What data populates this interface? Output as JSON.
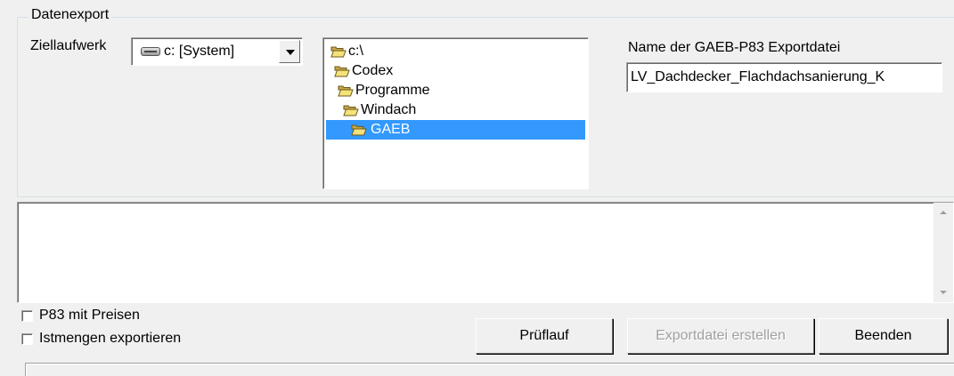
{
  "groupbox": {
    "title": "Datenexport"
  },
  "target_drive": {
    "label": "Ziellaufwerk",
    "selected": "c: [System]",
    "icon": "drive-icon"
  },
  "directory_tree": {
    "items": [
      {
        "label": "c:\\",
        "icon": "open-folder-icon"
      },
      {
        "label": "Codex",
        "icon": "open-folder-icon"
      },
      {
        "label": "Programme",
        "icon": "open-folder-icon"
      },
      {
        "label": "Windach",
        "icon": "open-folder-icon"
      },
      {
        "label": "GAEB",
        "icon": "open-folder-icon",
        "selected": true
      }
    ]
  },
  "export_file": {
    "label": "Name der GAEB-P83 Exportdatei",
    "value": "LV_Dachdecker_Flachdachsanierung_K"
  },
  "options": {
    "p83_prices": {
      "label": "P83 mit Preisen",
      "checked": false
    },
    "export_actual_quantities": {
      "label": "Istmengen exportieren",
      "checked": false
    }
  },
  "buttons": {
    "check_run": "Prüflauf",
    "create_export": "Exportdatei erstellen",
    "close": "Beenden"
  },
  "colors": {
    "window_bg": "#f0f0f0",
    "selection": "#3399ff",
    "folder_yellow": "#f5e27a",
    "disabled_text": "#a0a0a0"
  }
}
